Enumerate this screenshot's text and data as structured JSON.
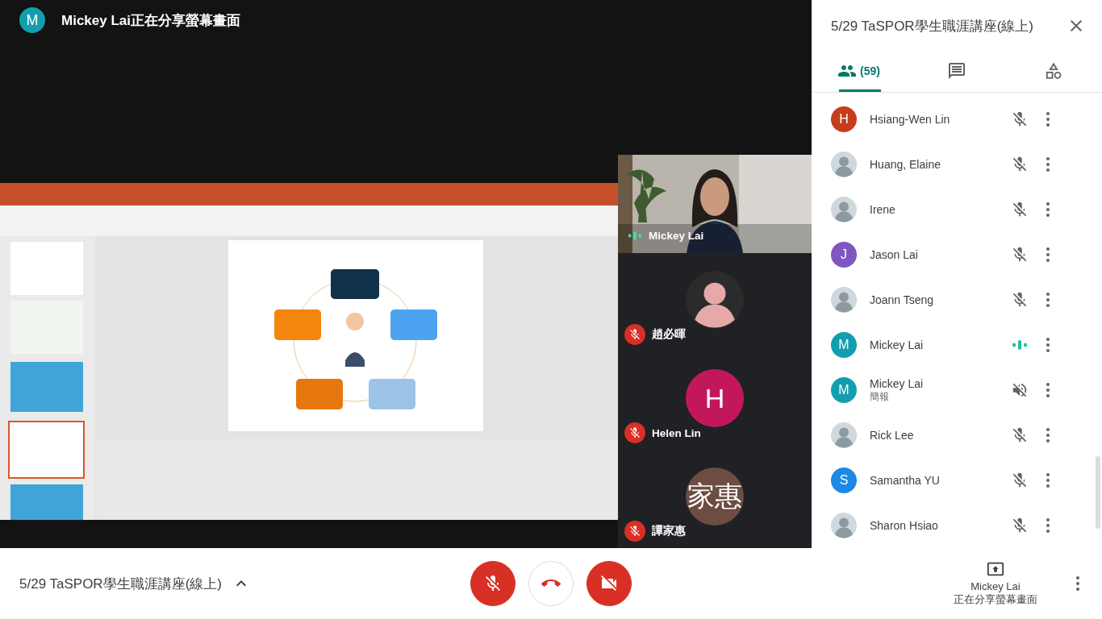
{
  "presenter_banner": {
    "avatar_letter": "M",
    "text": "Mickey Lai正在分享螢幕畫面"
  },
  "tiles": [
    {
      "kind": "camera",
      "name": "Mickey Lai",
      "muted": false
    },
    {
      "name": "趙必暉",
      "muted": true
    },
    {
      "kind": "letter",
      "letter": "H",
      "color": "#c2185b",
      "name": "Helen Lin",
      "muted": true
    },
    {
      "kind": "letter",
      "letter": "家惠",
      "color": "#6d4c41",
      "name": "譚家惠",
      "muted": true
    }
  ],
  "side_panel": {
    "title": "5/29 TaSPOR學生職涯講座(線上)",
    "tabs": [
      {
        "kind": "people",
        "label": "(59)",
        "selected": true
      },
      {
        "kind": "chat",
        "selected": false
      },
      {
        "kind": "activities",
        "selected": false
      }
    ],
    "participants": [
      {
        "kind": "letter",
        "letter": "H",
        "color": "#c53d1d",
        "name": "Hsiang-Wen Lin",
        "muted": true,
        "presentation": false
      },
      {
        "name": "Huang, Elaine",
        "muted": true,
        "presentation": false
      },
      {
        "name": "Irene",
        "muted": true,
        "presentation": false
      },
      {
        "kind": "letter",
        "letter": "J",
        "color": "#7e57c2",
        "name": "Jason Lai",
        "muted": true,
        "presentation": false
      },
      {
        "name": "Joann Tseng",
        "muted": true,
        "presentation": false
      },
      {
        "kind": "letter",
        "letter": "M",
        "color": "#129eaf",
        "name": "Mickey Lai",
        "muted": false,
        "presentation": false
      },
      {
        "kind": "letter",
        "letter": "M",
        "color": "#129eaf",
        "name": "Mickey Lai",
        "subtitle": "簡報",
        "muted": true,
        "presentation": true
      },
      {
        "name": "Rick Lee",
        "muted": true,
        "presentation": false
      },
      {
        "kind": "letter",
        "letter": "S",
        "color": "#1e88e5",
        "name": "Samantha YU",
        "muted": true,
        "presentation": false
      },
      {
        "name": "Sharon Hsiao",
        "muted": true,
        "presentation": false
      }
    ]
  },
  "bottom_bar": {
    "meeting_title": "5/29 TaSPOR學生職涯講座(線上)",
    "controls": [
      {
        "kind": "mic",
        "off": true
      },
      {
        "kind": "hangup"
      },
      {
        "kind": "camera",
        "off": true
      }
    ],
    "presenting": {
      "name": "Mickey Lai",
      "status": "正在分享螢幕畫面"
    }
  }
}
